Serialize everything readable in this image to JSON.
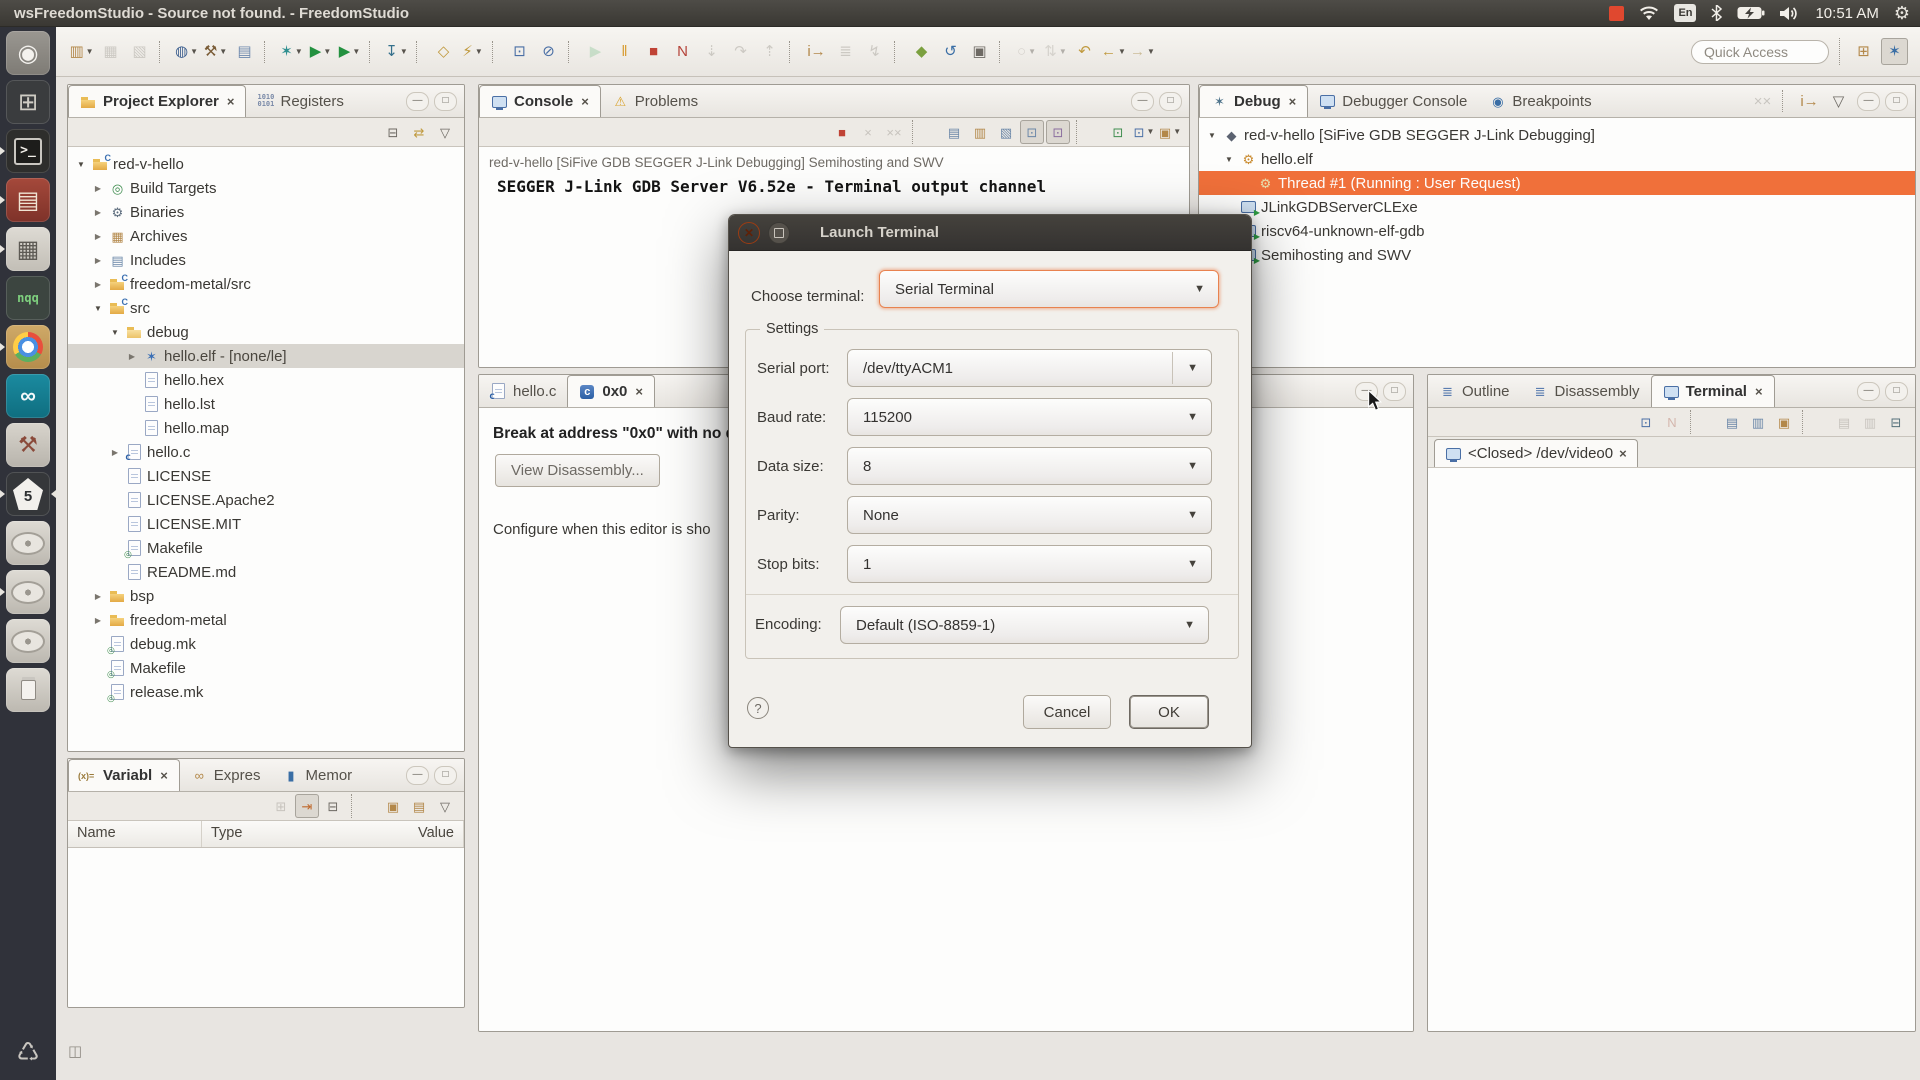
{
  "system_bar": {
    "title": "wsFreedomStudio - Source not found. - FreedomStudio",
    "keyboard_layout": "En",
    "time": "10:51 AM",
    "tray_icons": [
      "record-indicator",
      "wifi",
      "keyboard-layout",
      "bluetooth",
      "battery-charging",
      "volume",
      "clock",
      "session-menu"
    ]
  },
  "launcher": {
    "items": [
      {
        "name": "ubuntu-dash",
        "kind": "ubuntu"
      },
      {
        "name": "workspace-switcher",
        "kind": "workspace"
      },
      {
        "name": "terminal-app",
        "kind": "terminal",
        "running": 1
      },
      {
        "name": "file-cabinet",
        "kind": "cabinet",
        "running": 1
      },
      {
        "name": "calculator",
        "kind": "calculator",
        "running": 1
      },
      {
        "name": "notepadqq",
        "kind": "nqq"
      },
      {
        "name": "chrome",
        "kind": "chrome",
        "running": 1
      },
      {
        "name": "arduino",
        "kind": "arduino"
      },
      {
        "name": "system-tools",
        "kind": "tools"
      },
      {
        "name": "freedomstudio",
        "kind": "fstudio",
        "running": 1,
        "focused": 1
      },
      {
        "name": "disk-1",
        "kind": "disk"
      },
      {
        "name": "disk-2",
        "kind": "disk",
        "running": 1
      },
      {
        "name": "disk-3",
        "kind": "disk"
      },
      {
        "name": "usb-drive",
        "kind": "usb"
      },
      {
        "name": "trash",
        "kind": "trash"
      }
    ]
  },
  "toolbar": {
    "quick_access_placeholder": "Quick Access",
    "items": [
      {
        "name": "new-wizard",
        "g": "▥",
        "c": "#b3884a",
        "dd": 1
      },
      {
        "name": "save",
        "g": "▦",
        "c": "#98948c",
        "dis": 1
      },
      {
        "name": "save-all",
        "g": "▧",
        "c": "#98948c",
        "dis": 1
      },
      {
        "t": "sep",
        "inter": "false"
      },
      {
        "name": "target-config",
        "g": "◍",
        "c": "#3c5e8e",
        "dd": 1
      },
      {
        "name": "build",
        "g": "⚒",
        "c": "#7a5c36",
        "dd": 1
      },
      {
        "name": "binary-utilities",
        "g": "▤",
        "c": "#6e89ad"
      },
      {
        "t": "sep",
        "inter": "false"
      },
      {
        "name": "debug-launch",
        "g": "✶",
        "c": "#2f8f8f",
        "dd": 1
      },
      {
        "name": "run",
        "g": "▶",
        "c": "#23913f",
        "dd": 1
      },
      {
        "name": "external-tools",
        "g": "▶",
        "c": "#23913f",
        "dd": 1
      },
      {
        "t": "sep",
        "inter": "false"
      },
      {
        "name": "flash-program",
        "g": "↧",
        "c": "#35708c",
        "dd": 1
      },
      {
        "t": "sep",
        "inter": "false"
      },
      {
        "name": "new-cpp-element",
        "g": "◇",
        "c": "#c09a3f"
      },
      {
        "name": "search",
        "g": "⚡",
        "c": "#c09a3f",
        "dd": 1
      },
      {
        "t": "sep",
        "inter": "false"
      },
      {
        "name": "open-console-view",
        "g": "⊡",
        "c": "#4a6fa5"
      },
      {
        "name": "skip-all-breakpoints",
        "g": "⊘",
        "c": "#4a6fa5"
      },
      {
        "t": "sep",
        "inter": "false"
      },
      {
        "name": "resume",
        "g": "▶",
        "c": "#8fc79a",
        "dis": 1
      },
      {
        "name": "suspend",
        "g": "‖",
        "c": "#d79b2f"
      },
      {
        "name": "terminate",
        "g": "■",
        "c": "#c04335"
      },
      {
        "name": "disconnect",
        "g": "N",
        "c": "#b5443a"
      },
      {
        "name": "step-into",
        "g": "⇣",
        "c": "#98948c",
        "dis": 1
      },
      {
        "name": "step-over",
        "g": "↷",
        "c": "#98948c",
        "dis": 1
      },
      {
        "name": "step-return",
        "g": "⇡",
        "c": "#98948c",
        "dis": 1
      },
      {
        "t": "sep",
        "inter": "false"
      },
      {
        "name": "instruction-stepping",
        "g": "i→",
        "c": "#b3884a"
      },
      {
        "name": "use-step-filters",
        "g": "≣",
        "c": "#98948c",
        "dis": 1
      },
      {
        "name": "drop-to-frame",
        "g": "↯",
        "c": "#98948c",
        "dis": 1
      },
      {
        "t": "sep",
        "inter": "false"
      },
      {
        "name": "profiling",
        "g": "◆",
        "c": "#7ba03f"
      },
      {
        "name": "restart",
        "g": "↺",
        "c": "#3a6ea5"
      },
      {
        "name": "memory-monitor",
        "g": "▣",
        "c": "#6e6a64"
      },
      {
        "t": "sep",
        "inter": "false"
      },
      {
        "name": "annotations",
        "g": "○",
        "c": "#b0aca4",
        "dd": 1,
        "dis": 1
      },
      {
        "name": "filters",
        "g": "⇅",
        "c": "#b0aca4",
        "dd": 1,
        "dis": 1
      },
      {
        "name": "last-edit-location",
        "g": "↶",
        "c": "#c09a3f"
      },
      {
        "name": "back",
        "g": "←",
        "c": "#c09a3f",
        "dd": 1
      },
      {
        "name": "forward",
        "g": "→",
        "c": "#cbbd98",
        "dd": 1
      }
    ],
    "perspective_buttons": [
      {
        "name": "open-perspective",
        "g": "⊞",
        "c": "#b3884a"
      },
      {
        "name": "debug-perspective",
        "g": "✶",
        "c": "#3a6ea5",
        "pressed": 1
      }
    ]
  },
  "panels": {
    "project_explorer": {
      "tabs": [
        {
          "label": "Project Explorer",
          "icon": "view-project",
          "selected": true,
          "closable": true
        },
        {
          "label": "Registers",
          "icon": "view-registers"
        }
      ],
      "toolbar": [
        {
          "name": "collapse-all",
          "g": "⊟",
          "c": "#6e6a64"
        },
        {
          "name": "link-with-editor",
          "g": "⇄",
          "c": "#c09a3f"
        },
        {
          "name": "view-menu",
          "g": "▽",
          "c": "#6e6a64"
        }
      ],
      "tree": [
        {
          "label": "red-v-hello",
          "depth": 0,
          "exp": "open",
          "icon": "c-project"
        },
        {
          "label": "Build Targets",
          "depth": 1,
          "exp": "closed",
          "icon": "build-targets"
        },
        {
          "label": "Binaries",
          "depth": 1,
          "exp": "closed",
          "icon": "binaries"
        },
        {
          "label": "Archives",
          "depth": 1,
          "exp": "closed",
          "icon": "archives"
        },
        {
          "label": "Includes",
          "depth": 1,
          "exp": "closed",
          "icon": "includes"
        },
        {
          "label": "freedom-metal/src",
          "depth": 1,
          "exp": "closed",
          "icon": "src-folder"
        },
        {
          "label": "src",
          "depth": 1,
          "exp": "open",
          "icon": "src-folder"
        },
        {
          "label": "debug",
          "depth": 2,
          "exp": "open",
          "icon": "folder-open"
        },
        {
          "label": "hello.elf - [none/le]",
          "depth": 3,
          "exp": "closed",
          "icon": "elf-file",
          "selected": true
        },
        {
          "label": "hello.hex",
          "depth": 3,
          "icon": "file"
        },
        {
          "label": "hello.lst",
          "depth": 3,
          "icon": "file"
        },
        {
          "label": "hello.map",
          "depth": 3,
          "icon": "file"
        },
        {
          "label": "hello.c",
          "depth": 2,
          "exp": "closed",
          "icon": "c-file"
        },
        {
          "label": "LICENSE",
          "depth": 2,
          "icon": "file"
        },
        {
          "label": "LICENSE.Apache2",
          "depth": 2,
          "icon": "file"
        },
        {
          "label": "LICENSE.MIT",
          "depth": 2,
          "icon": "file"
        },
        {
          "label": "Makefile",
          "depth": 2,
          "icon": "makefile"
        },
        {
          "label": "README.md",
          "depth": 2,
          "icon": "file"
        },
        {
          "label": "bsp",
          "depth": 1,
          "exp": "closed",
          "icon": "folder"
        },
        {
          "label": "freedom-metal",
          "depth": 1,
          "exp": "closed",
          "icon": "folder"
        },
        {
          "label": "debug.mk",
          "depth": 1,
          "icon": "makefile"
        },
        {
          "label": "Makefile",
          "depth": 1,
          "icon": "makefile"
        },
        {
          "label": "release.mk",
          "depth": 1,
          "icon": "makefile"
        }
      ]
    },
    "console": {
      "tabs": [
        {
          "label": "Console",
          "icon": "view-console",
          "selected": true,
          "closable": true
        },
        {
          "label": "Problems",
          "icon": "view-problems"
        }
      ],
      "toolbar": [
        {
          "name": "terminate",
          "g": "■",
          "c": "#c04335"
        },
        {
          "name": "remove-launch",
          "g": "×",
          "c": "#8f8b84",
          "dis": 1
        },
        {
          "name": "remove-all-terminated",
          "g": "××",
          "c": "#8f8b84",
          "dis": 1
        },
        {
          "t": "sep",
          "inter": "false"
        },
        {
          "name": "clear-console",
          "g": "▤",
          "c": "#6b87a8"
        },
        {
          "name": "scroll-lock",
          "g": "▥",
          "c": "#b3884a"
        },
        {
          "name": "word-wrap",
          "g": "▧",
          "c": "#6b87a8"
        },
        {
          "name": "show-stdout-when-changed",
          "g": "⊡",
          "c": "#6b87a8",
          "pressed": 1
        },
        {
          "name": "show-stderr-when-changed",
          "g": "⊡",
          "c": "#8a6d9e",
          "pressed": 1
        },
        {
          "t": "sep",
          "inter": "false"
        },
        {
          "name": "pin-console",
          "g": "⊡",
          "c": "#3f8d4f"
        },
        {
          "name": "display-selected-console",
          "g": "⊡",
          "c": "#4a6fa5",
          "dd": 1
        },
        {
          "name": "open-console",
          "g": "▣",
          "c": "#b3884a",
          "dd": 1
        }
      ],
      "connection_line": "red-v-hello [SiFive GDB SEGGER J-Link Debugging] Semihosting and SWV",
      "output_line": "SEGGER J-Link GDB Server V6.52e - Terminal output channel"
    },
    "debug": {
      "tabs": [
        {
          "label": "Debug",
          "icon": "view-debug",
          "selected": true,
          "closable": true
        },
        {
          "label": "Debugger Console",
          "icon": "view-debugger-console"
        },
        {
          "label": "Breakpoints",
          "icon": "view-breakpoints"
        }
      ],
      "toolbar": [
        {
          "name": "remove-all-terminated",
          "g": "××",
          "c": "#8f8b84",
          "dis": 1
        },
        {
          "t": "sep",
          "inter": "false"
        },
        {
          "name": "instruction-stepping",
          "g": "i→",
          "c": "#b3884a"
        },
        {
          "name": "view-menu",
          "g": "▽",
          "c": "#6e6a64"
        }
      ],
      "tree": [
        {
          "label": "red-v-hello [SiFive GDB SEGGER J-Link Debugging]",
          "depth": 0,
          "exp": "open",
          "icon": "launch"
        },
        {
          "label": "hello.elf",
          "depth": 1,
          "exp": "open",
          "icon": "runtime"
        },
        {
          "label": "Thread #1 (Running : User Request)",
          "depth": 2,
          "icon": "thread",
          "selected": true
        },
        {
          "label": "JLinkGDBServerCLExe",
          "depth": 1,
          "icon": "process"
        },
        {
          "label": "riscv64-unknown-elf-gdb",
          "depth": 1,
          "icon": "process"
        },
        {
          "label": "Semihosting and SWV",
          "depth": 1,
          "icon": "process"
        }
      ]
    },
    "editor": {
      "tabs": [
        {
          "label": "hello.c",
          "icon": "c-file"
        },
        {
          "label": "0x0",
          "icon": "address-editor",
          "selected": true,
          "closable": true
        }
      ],
      "message": "Break at address \"0x0\" with no d",
      "button_label": "View Disassembly...",
      "note": "Configure when this editor is sho"
    },
    "outline_terminal": {
      "tabs": [
        {
          "label": "Outline",
          "icon": "view-outline"
        },
        {
          "label": "Disassembly",
          "icon": "view-disassembly"
        },
        {
          "label": "Terminal",
          "icon": "view-terminal",
          "selected": true,
          "closable": true
        }
      ],
      "toolbar": [
        {
          "name": "connect-terminal",
          "g": "⊡",
          "c": "#4a6fa5"
        },
        {
          "name": "disconnect-terminal",
          "g": "N",
          "c": "#b06a5a",
          "dis": 1
        },
        {
          "t": "sep",
          "inter": "false"
        },
        {
          "name": "new-terminal-view",
          "g": "▤",
          "c": "#6b87a8"
        },
        {
          "name": "scroll-lock-terminal",
          "g": "▥",
          "c": "#6b87a8"
        },
        {
          "name": "terminal-settings",
          "g": "▣",
          "c": "#b3884a"
        },
        {
          "t": "sep",
          "inter": "false"
        },
        {
          "name": "copy",
          "g": "▤",
          "c": "#8f8b84",
          "dis": 1
        },
        {
          "name": "paste",
          "g": "▥",
          "c": "#8f8b84",
          "dis": 1
        },
        {
          "name": "toggle-command-input",
          "g": "⊟",
          "c": "#55707a"
        }
      ],
      "subtab_label": "<Closed> /dev/video0"
    },
    "variables": {
      "tabs": [
        {
          "label": "Variabl",
          "icon": "view-variables",
          "selected": true,
          "closable": true
        },
        {
          "label": "Expres",
          "icon": "view-expressions"
        },
        {
          "label": "Memor",
          "icon": "view-memory"
        }
      ],
      "toolbar": [
        {
          "name": "show-type-names",
          "g": "⊞",
          "c": "#8f8b84",
          "dis": 1
        },
        {
          "name": "show-logical-structure",
          "g": "⇥",
          "c": "#c06a2e",
          "pressed": 1
        },
        {
          "name": "collapse-all",
          "g": "⊟",
          "c": "#6e6a64"
        },
        {
          "t": "sep",
          "inter": "false"
        },
        {
          "name": "new-watch",
          "g": "▣",
          "c": "#b3884a"
        },
        {
          "name": "edit-watch",
          "g": "▤",
          "c": "#b3884a"
        },
        {
          "name": "view-menu",
          "g": "▽",
          "c": "#6e6a64"
        }
      ],
      "columns": [
        {
          "label": "Name"
        },
        {
          "label": "Type"
        },
        {
          "label": "Value"
        }
      ]
    }
  },
  "dialog": {
    "title": "Launch Terminal",
    "choose_terminal_label": "Choose terminal:",
    "choose_terminal_value": "Serial Terminal",
    "settings_label": "Settings",
    "fields": [
      {
        "name": "serial-port-combo",
        "label": "Serial port:",
        "value": "/dev/ttyACM1",
        "divided": true
      },
      {
        "name": "baud-rate-combo",
        "label": "Baud rate:",
        "value": "115200"
      },
      {
        "name": "data-size-combo",
        "label": "Data size:",
        "value": "8"
      },
      {
        "name": "parity-combo",
        "label": "Parity:",
        "value": "None"
      },
      {
        "name": "stop-bits-combo",
        "label": "Stop bits:",
        "value": "1"
      }
    ],
    "encoding_label": "Encoding:",
    "encoding_value": "Default (ISO-8859-1)",
    "help_label": "?",
    "cancel_label": "Cancel",
    "ok_label": "OK"
  }
}
